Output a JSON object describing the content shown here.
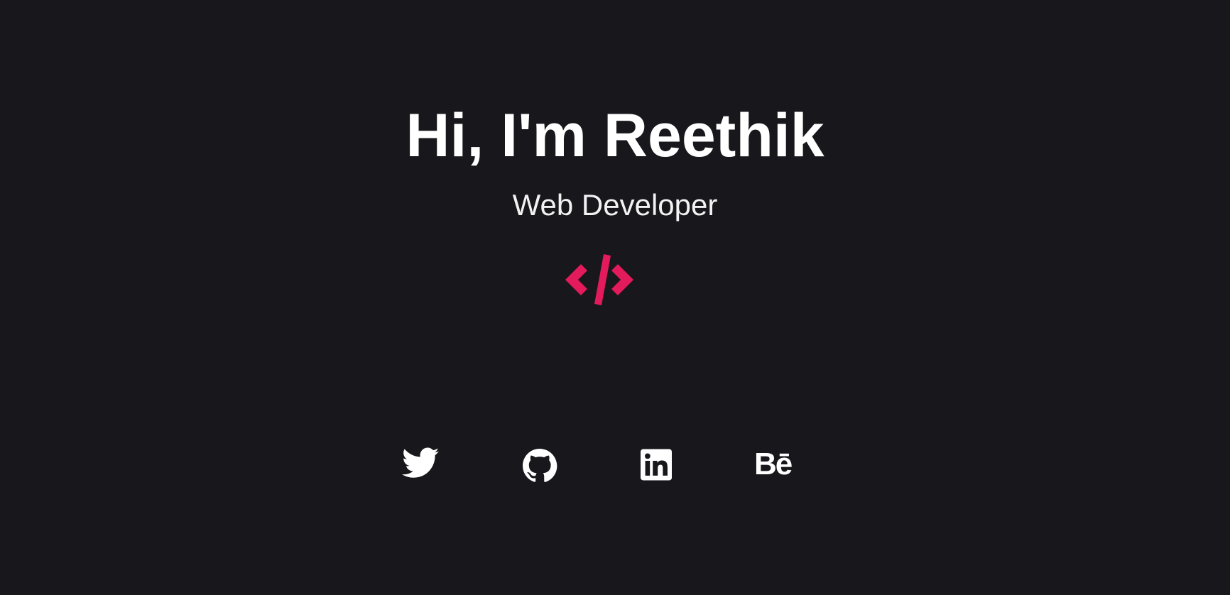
{
  "hero": {
    "greeting": "Hi, I'm Reethik",
    "role": "Web Developer",
    "logo_icon": "code-slash-icon",
    "accent_color": "#e31b5d"
  },
  "socials": [
    {
      "icon": "twitter-icon"
    },
    {
      "icon": "github-icon"
    },
    {
      "icon": "linkedin-icon"
    },
    {
      "icon": "behance-icon",
      "glyph": "Bē"
    }
  ],
  "colors": {
    "background": "#17171c",
    "text": "#ffffff",
    "accent": "#e31b5d"
  }
}
